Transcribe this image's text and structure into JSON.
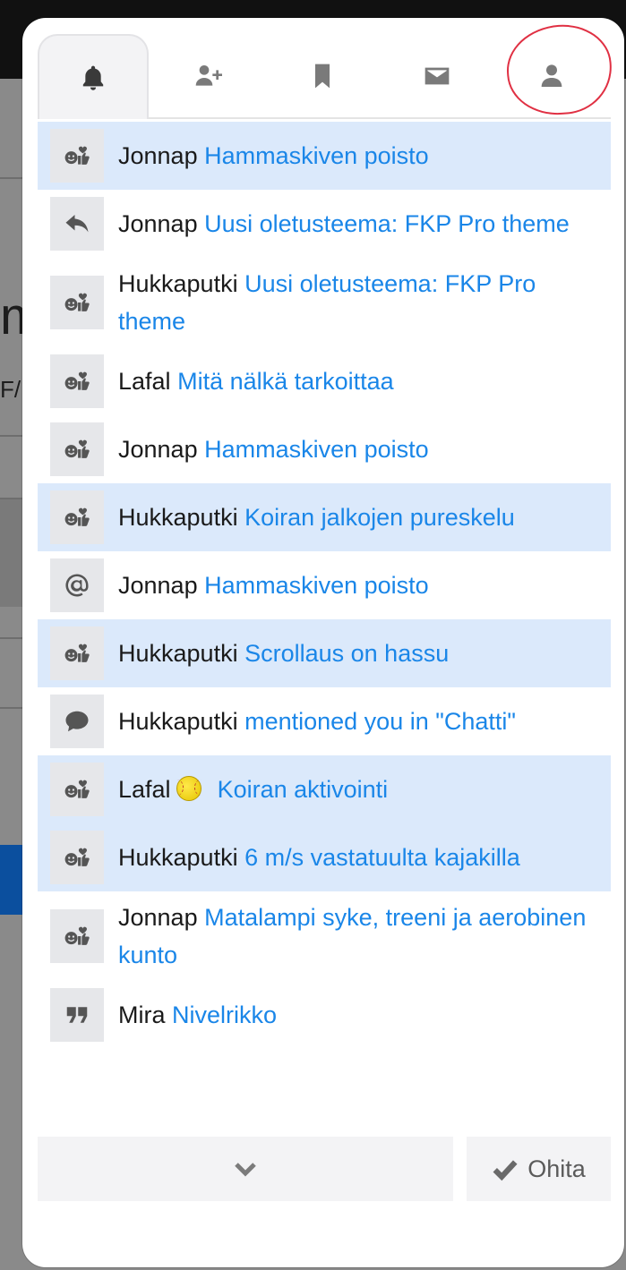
{
  "tabs": [
    {
      "icon": "bell-icon",
      "active": true
    },
    {
      "icon": "user-plus-icon",
      "active": false
    },
    {
      "icon": "bookmark-icon",
      "active": false
    },
    {
      "icon": "envelope-icon",
      "active": false
    },
    {
      "icon": "user-icon",
      "active": false
    }
  ],
  "notifications": [
    {
      "user": "Jonnap",
      "title": "Hammaskiven poisto",
      "icon": "reaction-icon",
      "unread": true
    },
    {
      "user": "Jonnap",
      "title": "Uusi oletusteema: FKP Pro theme",
      "icon": "reply-icon",
      "unread": false
    },
    {
      "user": "Hukkaputki",
      "title": "Uusi oletusteema: FKP Pro theme",
      "icon": "reaction-icon",
      "unread": false
    },
    {
      "user": "Lafal",
      "title": "Mitä nälkä tarkoittaa",
      "icon": "reaction-icon",
      "unread": false
    },
    {
      "user": "Jonnap",
      "title": "Hammaskiven poisto",
      "icon": "reaction-icon",
      "unread": false
    },
    {
      "user": "Hukkaputki",
      "title": "Koiran jalkojen pureskelu",
      "icon": "reaction-icon",
      "unread": true
    },
    {
      "user": "Jonnap",
      "title": "Hammaskiven poisto",
      "icon": "mention-icon",
      "unread": false
    },
    {
      "user": "Hukkaputki",
      "title": "Scrollaus on hassu",
      "icon": "reaction-icon",
      "unread": true
    },
    {
      "user": "Hukkaputki",
      "title": "mentioned you in \"Chatti\"",
      "icon": "chat-bubble-icon",
      "unread": false
    },
    {
      "user": "Lafal",
      "title": "Koiran aktivointi",
      "icon": "reaction-icon",
      "unread": true,
      "emoji": "softball-icon"
    },
    {
      "user": "Hukkaputki",
      "title": "6 m/s vastatuulta kajakilla",
      "icon": "reaction-icon",
      "unread": true
    },
    {
      "user": "Jonnap",
      "title": "Matalampi syke, treeni ja aerobinen kunto",
      "icon": "reaction-icon",
      "unread": false
    },
    {
      "user": "Mira",
      "title": "Nivelrikko",
      "icon": "quote-icon",
      "unread": false
    }
  ],
  "footer": {
    "expand_icon": "chevron-down-icon",
    "dismiss_label": "Ohita",
    "dismiss_icon": "check-icon"
  },
  "colors": {
    "unread_bg": "#dbe9fb",
    "link": "#1a86e8",
    "annotation": "#e03043"
  }
}
